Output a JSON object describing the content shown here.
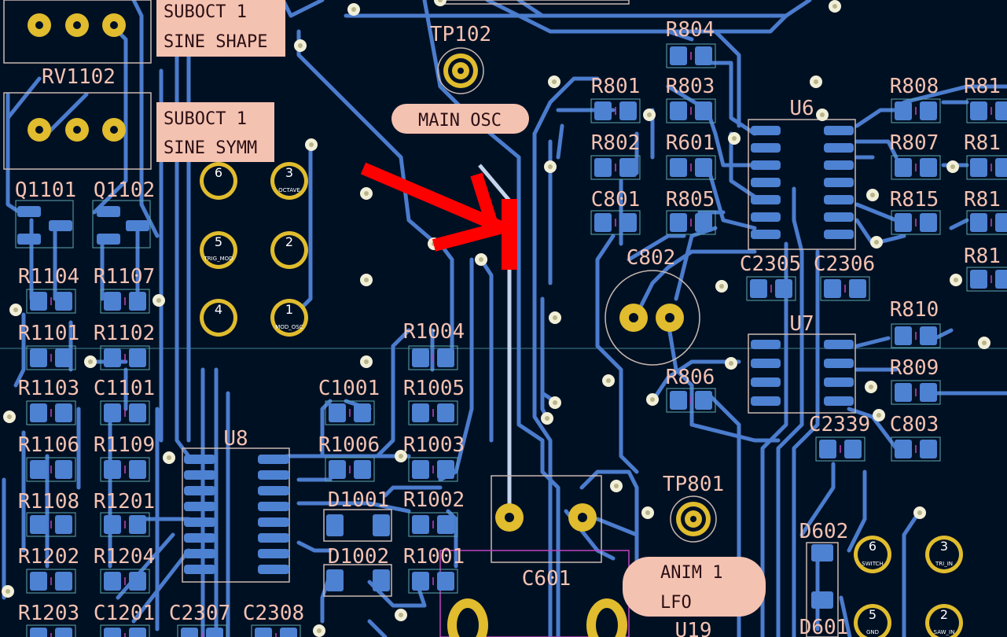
{
  "colors": {
    "board": "#001023",
    "copper_back": "#4b7ccd",
    "pad_back": "#4d81d2",
    "pad_outline": "#9fb8e8",
    "silkscreen": "#f4c2b1",
    "via_ring": "#f2efd8",
    "through_hole": "#e0bc2e",
    "selected_trace": "#c3d4ec",
    "annotation_arrow": "#ff0000",
    "label_box": "#f4c2b1"
  },
  "labels": {
    "suboct_shape_l1": "SUBOCT 1",
    "suboct_shape_l2": "SINE SHAPE",
    "suboct_symm_l1": "SUBOCT 1",
    "suboct_symm_l2": "SINE SYMM",
    "main_osc": "MAIN OSC",
    "anim_l1": "ANIM 1",
    "anim_l2": "LFO"
  },
  "refs": {
    "RV1102": "RV1102",
    "TP102": "TP102",
    "TP801": "TP801",
    "R804": "R804",
    "R801": "R801",
    "R803": "R803",
    "R802": "R802",
    "R601": "R601",
    "C801": "C801",
    "R805": "R805",
    "C802": "C802",
    "U6": "U6",
    "U7": "U7",
    "U8": "U8",
    "U19": "U19",
    "R808": "R808",
    "R81x_a": "R81",
    "R807": "R807",
    "R81x_b": "R81",
    "R815": "R815",
    "R81x_c": "R81",
    "R81x_d": "R81",
    "C2305": "C2305",
    "C2306": "C2306",
    "R810": "R810",
    "R809": "R809",
    "R806": "R806",
    "C2339": "C2339",
    "C803": "C803",
    "Q1101": "Q1101",
    "Q1102": "Q1102",
    "R1104": "R1104",
    "R1107": "R1107",
    "R1101": "R1101",
    "R1102": "R1102",
    "R1103": "R1103",
    "C1101": "C1101",
    "R1106": "R1106",
    "R1109": "R1109",
    "R1108": "R1108",
    "R1201": "R1201",
    "R1202": "R1202",
    "R1204": "R1204",
    "R1203": "R1203",
    "C1201": "C1201",
    "C2307": "C2307",
    "C2308": "C2308",
    "R1004": "R1004",
    "C1001": "C1001",
    "R1005": "R1005",
    "R1006": "R1006",
    "R1003": "R1003",
    "D1001": "D1001",
    "R1002": "R1002",
    "D1002": "D1002",
    "R1001": "R1001",
    "C601": "C601",
    "D602": "D602",
    "D601": "D601"
  },
  "pins": {
    "j_left": [
      "6",
      "3",
      "5",
      "2",
      "4",
      "1"
    ],
    "j_left_names": [
      "",
      "OCTAVE",
      "TRIG_MOD",
      "",
      "",
      "MOD_OSC"
    ],
    "j_right": [
      "6",
      "3",
      "5",
      "2"
    ],
    "j_right_names": [
      "SWITCH",
      "TRI_IN",
      "GND",
      "SAW_IN"
    ]
  }
}
